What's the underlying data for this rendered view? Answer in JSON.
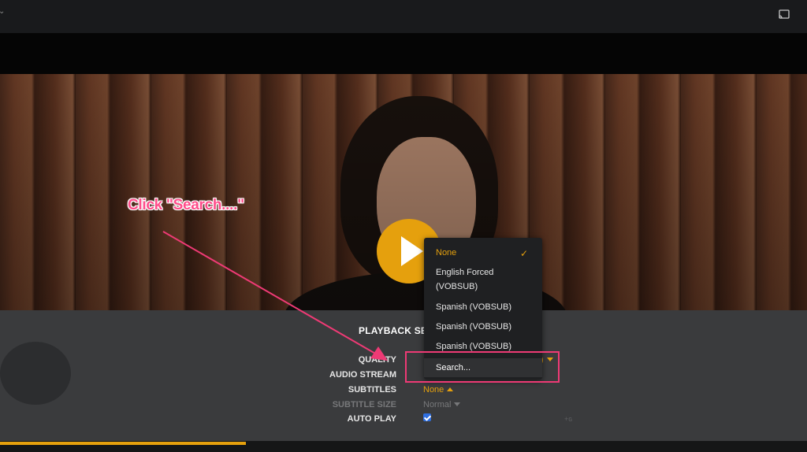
{
  "top_bar": {
    "cast_icon": "cast-icon",
    "menu_icon": "chevron-down-icon"
  },
  "player": {
    "play_icon": "play-icon",
    "progress_fraction": 0.305
  },
  "panel": {
    "title": "PLAYBACK SE",
    "settings": [
      {
        "label": "QUALITY",
        "value": ")"
      },
      {
        "label": "AUDIO STREAM",
        "value": ""
      },
      {
        "label": "SUBTITLES",
        "value": "None"
      },
      {
        "label": "SUBTITLE SIZE",
        "value": "Normal"
      },
      {
        "label": "AUTO PLAY",
        "checked": true
      }
    ]
  },
  "subtitles_dropdown": {
    "items": [
      {
        "label": "None",
        "selected": true
      },
      {
        "label": "English Forced (VOBSUB)"
      },
      {
        "label": "Spanish (VOBSUB)"
      },
      {
        "label": "Spanish (VOBSUB)"
      },
      {
        "label": "Spanish (VOBSUB)"
      },
      {
        "label": "Search..."
      }
    ],
    "check_icon": "check-icon"
  },
  "annotation": {
    "text": "Click \"Search....\"",
    "color": "#ee3a75"
  },
  "colors": {
    "accent": "#e5a00d",
    "annotation": "#ee3a75",
    "panel_bg": "#3a3b3d",
    "dropdown_bg": "#1f2022"
  }
}
